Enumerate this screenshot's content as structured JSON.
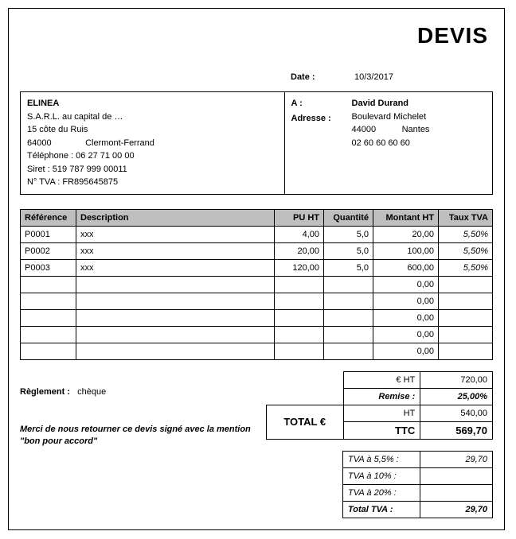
{
  "title": "DEVIS",
  "date_label": "Date :",
  "date_value": "10/3/2017",
  "company": {
    "name": "ELINEA",
    "legal": "S.A.R.L. au capital de …",
    "street": "15 côte du Ruis",
    "zip": "64000",
    "city": "Clermont-Ferrand",
    "phone_label": "Téléphone :",
    "phone": "06 27 71 00 00",
    "siret_label": "Siret :",
    "siret": "519 787 999 00011",
    "vat_label": "N° TVA :",
    "vat": "FR895645875"
  },
  "client": {
    "to_label": "A :",
    "addr_label": "Adresse :",
    "name": "David Durand",
    "street": "Boulevard Michelet",
    "zip": "44000",
    "city": "Nantes",
    "phone": "02 60 60 60 60"
  },
  "columns": {
    "ref": "Référence",
    "desc": "Description",
    "pu": "PU HT",
    "qte": "Quantité",
    "mht": "Montant HT",
    "tva": "Taux TVA"
  },
  "items": [
    {
      "ref": "P0001",
      "desc": "xxx",
      "pu": "4,00",
      "qte": "5,0",
      "mht": "20,00",
      "tva": "5,50%"
    },
    {
      "ref": "P0002",
      "desc": "xxx",
      "pu": "20,00",
      "qte": "5,0",
      "mht": "100,00",
      "tva": "5,50%"
    },
    {
      "ref": "P0003",
      "desc": "xxx",
      "pu": "120,00",
      "qte": "5,0",
      "mht": "600,00",
      "tva": "5,50%"
    }
  ],
  "empty_mht": [
    "0,00",
    "0,00",
    "0,00",
    "0,00",
    "0,00"
  ],
  "payment": {
    "label": "Règlement :",
    "value": "chèque"
  },
  "footnote": "Merci de nous retourner ce devis signé avec la mention \"bon pour accord\"",
  "totals": {
    "ht_label": "€ HT",
    "ht_value": "720,00",
    "remise_label": "Remise :",
    "remise_value": "25,00%",
    "total_label": "TOTAL €",
    "ht2_label": "HT",
    "ht2_value": "540,00",
    "ttc_label": "TTC",
    "ttc_value": "569,70"
  },
  "tva_detail": {
    "r55_label": "TVA à 5,5% :",
    "r55_value": "29,70",
    "r10_label": "TVA à 10% :",
    "r10_value": "",
    "r20_label": "TVA à 20% :",
    "r20_value": "",
    "tot_label": "Total TVA :",
    "tot_value": "29,70"
  }
}
